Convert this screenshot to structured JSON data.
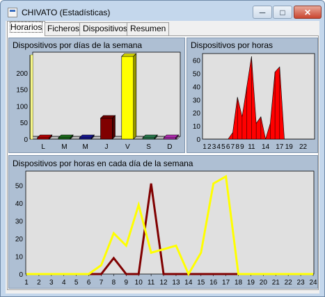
{
  "window": {
    "title": "CHIVATO (Estadísticas)",
    "min_glyph": "─",
    "max_glyph": "□",
    "close_glyph": "✕"
  },
  "tabs": [
    {
      "label": "Horarios",
      "active": true
    },
    {
      "label": "Ficheros",
      "active": false
    },
    {
      "label": "Dispositivos",
      "active": false
    },
    {
      "label": "Resumen",
      "active": false
    }
  ],
  "panels": {
    "days": {
      "title": "Dispositivos por días de la semana"
    },
    "hours": {
      "title": "Dispositivos por horas"
    },
    "dayhours": {
      "title": "Dispositivos por horas en cada día de la semana"
    }
  },
  "chart_data": [
    {
      "type": "bar",
      "title": "Dispositivos por días de la semana",
      "categories": [
        "L",
        "M",
        "M",
        "J",
        "V",
        "S",
        "D"
      ],
      "values": [
        0,
        0,
        0,
        63,
        250,
        0,
        0
      ],
      "colors": [
        "#cc0000",
        "#1f7a1f",
        "#1a1aa6",
        "#800000",
        "#ffff00",
        "#2e8b57",
        "#cc33cc"
      ],
      "ylim": [
        0,
        250
      ],
      "yticks": [
        0,
        50,
        100,
        150,
        200
      ],
      "style": "3d"
    },
    {
      "type": "area",
      "title": "Dispositivos por horas",
      "x": [
        1,
        2,
        3,
        4,
        5,
        6,
        7,
        8,
        9,
        10,
        11,
        12,
        13,
        14,
        15,
        16,
        17,
        18,
        19,
        20,
        21,
        22,
        23,
        24
      ],
      "values": [
        0,
        0,
        0,
        0,
        0,
        0,
        5,
        32,
        17,
        40,
        63,
        12,
        17,
        0,
        12,
        51,
        55,
        0,
        0,
        0,
        0,
        0,
        0,
        0
      ],
      "color": "#ff0000",
      "xtick_labels": [
        "1",
        "2",
        "3",
        "4",
        "5",
        "6",
        "7",
        "8",
        "9",
        "11",
        "14",
        "17",
        "19",
        "22"
      ],
      "ylim": [
        0,
        63
      ],
      "yticks": [
        0,
        10,
        20,
        30,
        40,
        50,
        60
      ]
    },
    {
      "type": "line",
      "title": "Dispositivos por horas en cada día de la semana",
      "x": [
        1,
        2,
        3,
        4,
        5,
        6,
        7,
        8,
        9,
        10,
        11,
        12,
        13,
        14,
        15,
        16,
        17,
        18,
        19,
        20,
        21,
        22,
        23,
        24
      ],
      "series": [
        {
          "color": "#800000",
          "values": [
            0,
            0,
            0,
            0,
            0,
            0,
            0,
            9,
            0,
            0,
            51,
            0,
            0,
            0,
            0,
            0,
            0,
            0,
            0,
            0,
            0,
            0,
            0,
            0
          ]
        },
        {
          "color": "#ffff00",
          "values": [
            0,
            0,
            0,
            0,
            0,
            0,
            5,
            23,
            16,
            39,
            12,
            14,
            16,
            0,
            12,
            51,
            55,
            0,
            0,
            0,
            0,
            0,
            0,
            0
          ]
        }
      ],
      "ylim": [
        0,
        58
      ],
      "yticks": [
        0,
        10,
        20,
        30,
        40,
        50
      ]
    }
  ]
}
